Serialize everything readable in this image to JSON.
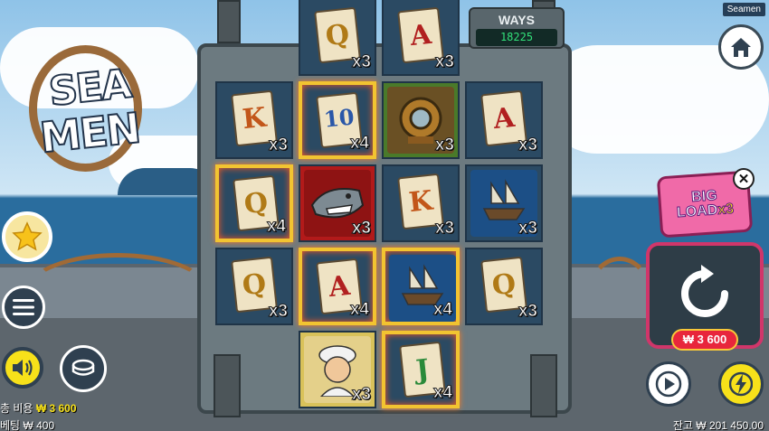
{
  "game": {
    "title": "Seamen",
    "logo_line1": "SEA",
    "logo_line2": "MEN"
  },
  "ways": {
    "label": "WAYS",
    "value": "18225"
  },
  "grid": {
    "cells": [
      {
        "symbol": "Q",
        "kind": "card",
        "mult": "x3"
      },
      {
        "symbol": "A",
        "kind": "card",
        "mult": "x3"
      },
      {
        "symbol": "K",
        "kind": "card",
        "mult": "x3"
      },
      {
        "symbol": "10",
        "kind": "card",
        "mult": "x4"
      },
      {
        "symbol": "diving-helmet",
        "kind": "pic",
        "mult": "x3"
      },
      {
        "symbol": "A",
        "kind": "card",
        "mult": "x3"
      },
      {
        "symbol": "Q",
        "kind": "card",
        "mult": "x4"
      },
      {
        "symbol": "shark",
        "kind": "pic",
        "mult": "x3"
      },
      {
        "symbol": "K",
        "kind": "card",
        "mult": "x3"
      },
      {
        "symbol": "ship",
        "kind": "pic",
        "mult": "x3"
      },
      {
        "symbol": "Q",
        "kind": "card",
        "mult": "x3"
      },
      {
        "symbol": "A",
        "kind": "card",
        "mult": "x4"
      },
      {
        "symbol": "ship",
        "kind": "pic",
        "mult": "x4"
      },
      {
        "symbol": "Q",
        "kind": "card",
        "mult": "x3"
      },
      {
        "symbol": "sailor",
        "kind": "pic",
        "mult": "x3"
      },
      {
        "symbol": "J",
        "kind": "card",
        "mult": "x4"
      }
    ]
  },
  "feature": {
    "line1": "BIG",
    "line2": "LOAD",
    "mult": "x3"
  },
  "spin": {
    "price": "₩ 3 600"
  },
  "footer": {
    "total_cost_label": "총 비용",
    "total_cost_value": "₩ 3 600",
    "bet_label": "베팅",
    "bet_value": "₩ 400",
    "balance_label": "잔고",
    "balance_value": "₩ 201 450.00"
  },
  "icons": {
    "home": "home-icon",
    "menu": "menu-icon",
    "sound": "sound-icon",
    "coin": "coin-icon",
    "star": "star-icon",
    "play": "play-icon",
    "turbo": "lightning-icon",
    "close": "close-icon",
    "spin": "spin-icon"
  },
  "colors": {
    "accent_pink": "#f06aa8",
    "spin_red": "#e8263c",
    "turbo_yellow": "#f7e11a",
    "ways_green": "#32e07a"
  }
}
